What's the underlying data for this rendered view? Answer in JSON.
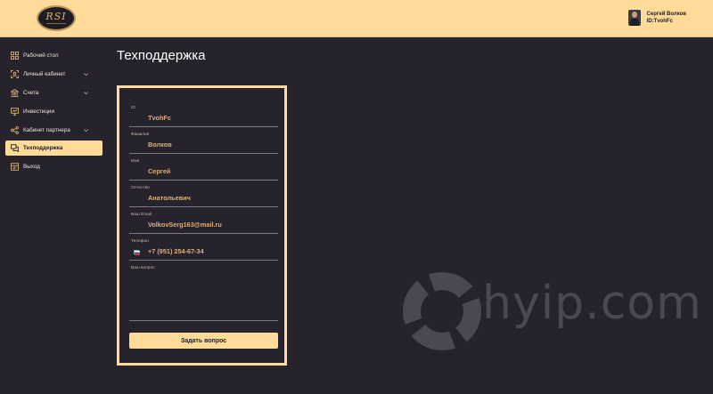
{
  "header": {
    "logo_text": "RSI",
    "user_name": "Сергей Волков",
    "user_id": "ID:TvohFc"
  },
  "sidebar": {
    "items": [
      {
        "label": "Рабочий стол",
        "icon": "dashboard-icon"
      },
      {
        "label": "Личный кабинет",
        "icon": "user-scan-icon",
        "has_chevron": true
      },
      {
        "label": "Счета",
        "icon": "bank-icon",
        "has_chevron": true
      },
      {
        "label": "Инвестиции",
        "icon": "monitor-chart-icon"
      },
      {
        "label": "Кабинет партнера",
        "icon": "share-network-icon",
        "has_chevron": true
      },
      {
        "label": "Техподдержка",
        "icon": "support-chat-icon",
        "active": true
      },
      {
        "label": "Выход",
        "icon": "exit-icon"
      }
    ]
  },
  "main": {
    "title": "Техподдержка"
  },
  "form": {
    "fields": [
      {
        "label": "ID",
        "value": "TvohFc"
      },
      {
        "label": "Фамилия",
        "value": "Волков"
      },
      {
        "label": "Имя",
        "value": "Сергей"
      },
      {
        "label": "Отчество",
        "value": "Анатольевич"
      },
      {
        "label": "Ваш Email",
        "value": "VolkovSerg163@mail.ru"
      },
      {
        "label": "Телефон",
        "value": "+7 (951) 254-67-34"
      }
    ],
    "question_label": "Ваш вопрос:",
    "question_value": "",
    "submit_label": "Задать вопрос"
  },
  "watermark": {
    "text": "hyip.com"
  },
  "colors": {
    "accent": "#ffdb9a",
    "background": "#26232d",
    "value_text": "#d9b077"
  }
}
